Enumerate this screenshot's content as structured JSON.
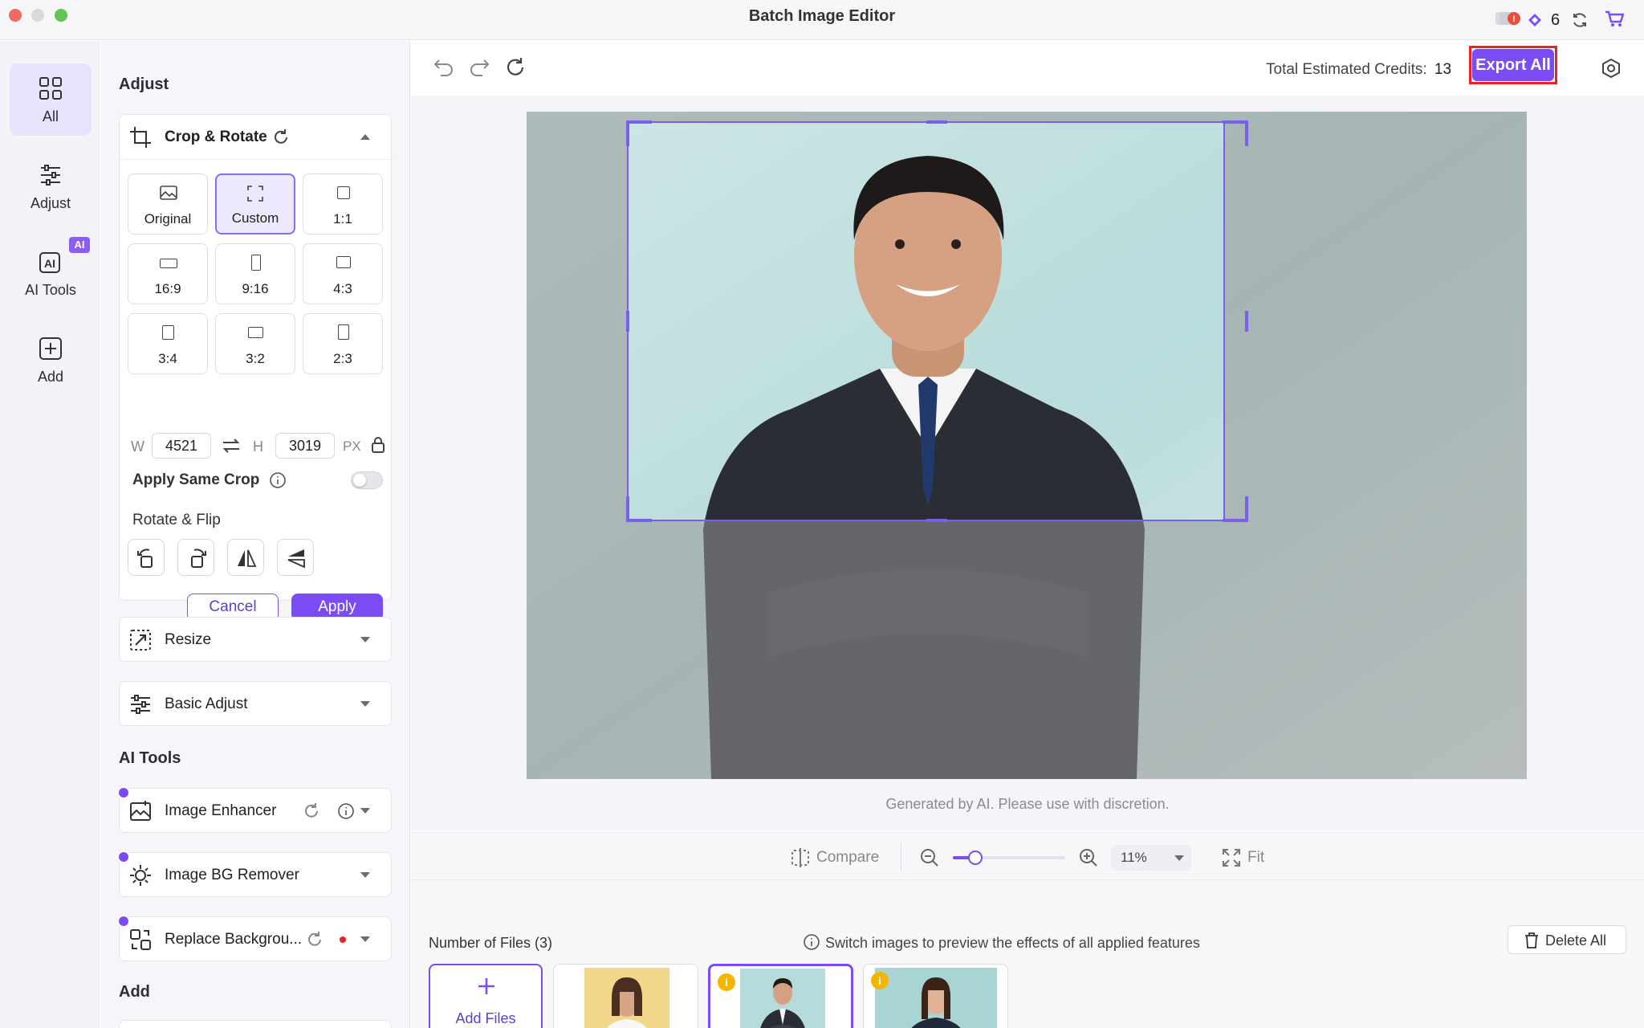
{
  "window": {
    "title": "Batch Image Editor",
    "credits_count": "6"
  },
  "nav": [
    {
      "label": "All",
      "icon": "grid-icon"
    },
    {
      "label": "Adjust",
      "icon": "sliders-icon"
    },
    {
      "label": "AI Tools",
      "icon": "ai-icon",
      "badge": "AI"
    },
    {
      "label": "Add",
      "icon": "plus-square-icon"
    }
  ],
  "panel": {
    "adjust_title": "Adjust",
    "crop": {
      "title": "Crop & Rotate",
      "ratios": [
        "Original",
        "Custom",
        "1:1",
        "16:9",
        "9:16",
        "4:3",
        "3:4",
        "3:2",
        "2:3"
      ],
      "selected_ratio": "Custom",
      "w_label": "W",
      "width": "4521",
      "h_label": "H",
      "height": "3019",
      "unit": "PX",
      "apply_same_crop": "Apply Same Crop",
      "apply_same_crop_on": false,
      "rotate_flip": "Rotate & Flip",
      "cancel": "Cancel",
      "apply": "Apply"
    },
    "resize": "Resize",
    "basic_adjust": "Basic Adjust",
    "ai_tools_title": "AI Tools",
    "ai_tools": [
      "Image Enhancer",
      "Image BG Remover",
      "Replace Backgrou..."
    ],
    "add_title": "Add"
  },
  "toolbar": {
    "credits_label": "Total Estimated Credits:",
    "credits_value": "13",
    "export": "Export All"
  },
  "canvas": {
    "disclaimer": "Generated by AI. Please use with discretion."
  },
  "zoom": {
    "compare": "Compare",
    "level": "11%",
    "fit": "Fit",
    "slider_fraction": 0.2
  },
  "files": {
    "count_label": "Number of Files (3)",
    "hint": "Switch images to preview the effects of all applied features",
    "delete_all": "Delete All",
    "add_files": "Add Files"
  },
  "colors": {
    "accent": "#7b4cf5",
    "highlight": "#e8231f"
  }
}
